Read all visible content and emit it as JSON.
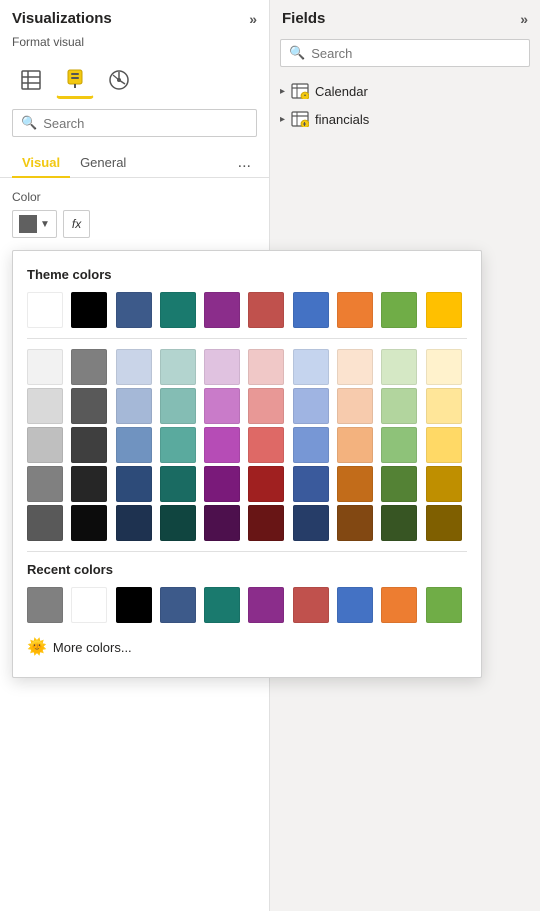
{
  "left_panel": {
    "title": "Visualizations",
    "format_visual_label": "Format visual",
    "search_placeholder": "Search",
    "tabs": [
      {
        "label": "Visual",
        "active": true
      },
      {
        "label": "General",
        "active": false
      }
    ],
    "tab_more": "...",
    "color_section": {
      "label": "Color",
      "fx_button": "fx"
    }
  },
  "right_panel": {
    "title": "Fields",
    "search_placeholder": "Search",
    "items": [
      {
        "label": "Calendar"
      },
      {
        "label": "financials"
      }
    ]
  },
  "color_picker": {
    "theme_colors_title": "Theme colors",
    "recent_colors_title": "Recent colors",
    "more_colors_label": "More colors...",
    "theme_rows": [
      [
        "#ffffff",
        "#000000",
        "#3d5a8a",
        "#1a7a6e",
        "#8b2d8b",
        "#c0514d",
        "#4472c4",
        "#ed7d31",
        "#70ad47",
        "#ffc000"
      ],
      [
        "#f2f2f2",
        "#7f7f7f",
        "#c9d4e8",
        "#b3d4cf",
        "#e0c2e0",
        "#f0c8c7",
        "#c5d4ee",
        "#fbe3cf",
        "#d5e8c5",
        "#fff2cc"
      ],
      [
        "#d9d9d9",
        "#595959",
        "#a5b8d7",
        "#84bdb4",
        "#c97bc9",
        "#e89896",
        "#9fb4e2",
        "#f7cbad",
        "#b2d59e",
        "#ffe699"
      ],
      [
        "#bfbfbf",
        "#3f3f3f",
        "#7093c0",
        "#5aaa9e",
        "#b64cb6",
        "#de6966",
        "#7797d5",
        "#f3b27e",
        "#8ec279",
        "#ffd966"
      ],
      [
        "#808080",
        "#262626",
        "#2d4b79",
        "#1a6b62",
        "#7a1a7a",
        "#a02020",
        "#3a5a9c",
        "#c26c1a",
        "#548235",
        "#bf8f00"
      ],
      [
        "#595959",
        "#0c0c0c",
        "#1e3250",
        "#104540",
        "#4d104d",
        "#681515",
        "#263d68",
        "#824812",
        "#375523",
        "#7f5f00"
      ]
    ],
    "recent_colors": [
      "#808080",
      "#ffffff",
      "#000000",
      "#3d5a8a",
      "#1a7a6e",
      "#8b2d8b",
      "#c0514d",
      "#4472c4",
      "#ed7d31",
      "#70ad47"
    ]
  }
}
